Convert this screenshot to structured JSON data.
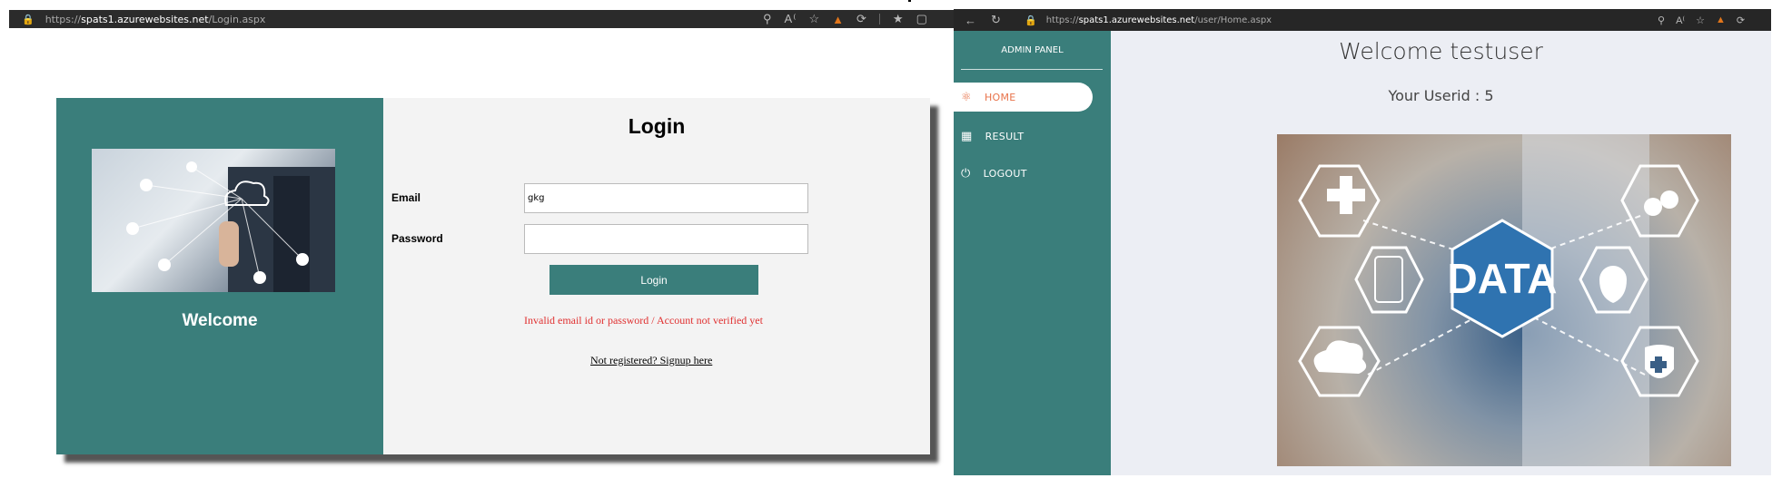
{
  "left_browser": {
    "url_proto": "https://",
    "url_host": "spats1.azurewebsites.net",
    "url_path": "/Login.aspx"
  },
  "login_panel": {
    "welcome": "Welcome",
    "title": "Login",
    "email_label": "Email",
    "email_value": "gkg",
    "password_label": "Password",
    "password_value": "",
    "login_button": "Login",
    "error_message": "Invalid email id or password / Account not verified yet",
    "register_link": "Not registered? Signup here"
  },
  "right_browser": {
    "url_proto": "https://",
    "url_host": "spats1.azurewebsites.net",
    "url_path": "/user/Home.aspx"
  },
  "admin": {
    "panel_title": "ADMIN PANEL",
    "nav": [
      {
        "label": "HOME",
        "icon": "atom-icon",
        "active": true
      },
      {
        "label": "RESULT",
        "icon": "map-icon",
        "active": false
      },
      {
        "label": "LOGOUT",
        "icon": "power-icon",
        "active": false
      }
    ],
    "welcome": "Welcome testuser",
    "userid": "Your Userid : 5",
    "hero_text": "DATA"
  },
  "colors": {
    "teal": "#3a7e7b",
    "active_nav": "#e8734a",
    "error": "#e03030"
  }
}
